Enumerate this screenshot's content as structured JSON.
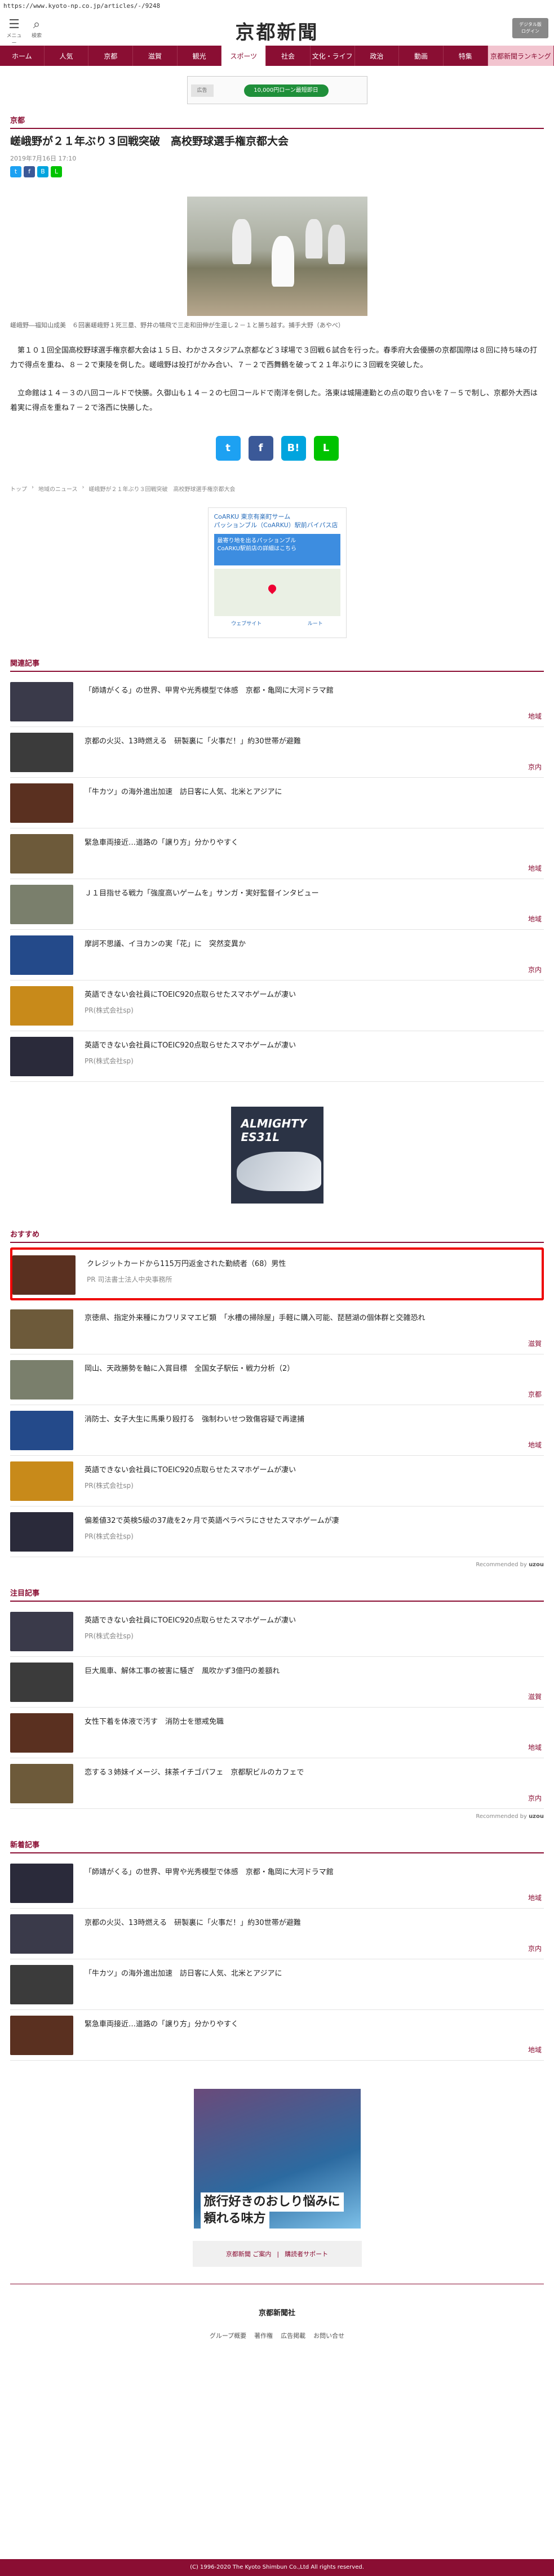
{
  "url": "https://www.kyoto-np.co.jp/articles/-/9248",
  "header": {
    "menu_label": "メニュー",
    "search_label": "検索",
    "logo": "京都新聞",
    "digital_label": "デジタル版\nログイン"
  },
  "nav": [
    "ホーム",
    "人気",
    "京都",
    "滋賀",
    "観光",
    "スポーツ",
    "社会",
    "文化・ライフ",
    "政治",
    "動画",
    "特集",
    "京都新聞ランキング"
  ],
  "ad_top": {
    "tag": "広告",
    "button": "10,000円ローン最短即日"
  },
  "article": {
    "section": "京都",
    "title": "嵯峨野が２１年ぶり３回戦突破　高校野球選手権京都大会",
    "date": "2019年7月16日 17:10",
    "caption": "嵯峨野―福知山成美　６回裏嵯峨野１死三塁、野井の犠飛で三走和田伸が生還し２－１と勝ち越す。捕手大野（あやべ）",
    "paragraphs": [
      "第１０１回全国高校野球選手権京都大会は１５日、わかさスタジアム京都など３球場で３回戦６試合を行った。春季府大会優勝の京都国際は８回に持ち味の打力で得点を重ね、８－２で東陵を倒した。嵯峨野は投打がかみ合い、７－２で西舞鶴を破って２１年ぶりに３回戦を突破した。",
      "立命館は１４－３の八回コールドで快勝。久御山も１４－２の七回コールドで南洋を倒した。洛東は城陽連勤との点の取り合いを７－５で制し、京都外大西は着実に得点を重ね７－２で洛西に快勝した。"
    ]
  },
  "breadcrumbs": [
    "トップ",
    "地域のニュース",
    "嵯峨野が２１年ぶり３回戦突破　高校野球選手権京都大会"
  ],
  "map_ad": {
    "title": "CoARKU 東京有楽町サーム\nパッションブル（CoARKU）駅前バイパス店",
    "box": "最寄り地を出るパッションブル\nCoARKU駅前店の詳細はこちら",
    "links": [
      "ウェブサイト",
      "ルート"
    ]
  },
  "related": {
    "heading": "関連記事",
    "items": [
      {
        "text": "「師靖がくる」の世界、甲冑や光秀模型で体感　京都・亀岡に大河ドラマ館",
        "src": "",
        "cat": "地域"
      },
      {
        "text": "京都の火災、13時燃える　研製裏に「火事だ！」約30世帯が避難",
        "src": "",
        "cat": "京内"
      },
      {
        "text": "「牛カツ」の海外進出加速　訪日客に人気、北米とアジアに",
        "src": "",
        "cat": ""
      },
      {
        "text": "緊急車両接近…道路の「譲り方」分かりやすく",
        "src": "",
        "cat": "地域"
      },
      {
        "text": "Ｊ１目指せる戦力「強度高いゲームを」サンガ・実好監督インタビュー",
        "src": "",
        "cat": "地域"
      },
      {
        "text": "摩訶不思議、イヨカンの実「花」に　突然変異か",
        "src": "",
        "cat": "京内"
      },
      {
        "text": "英語できない会社員にTOEIC920点取らせたスマホゲームが凄い",
        "src": "PR(株式会社sp)",
        "cat": ""
      },
      {
        "text": "英語できない会社員にTOEIC920点取らせたスマホゲームが凄い",
        "src": "PR(株式会社sp)",
        "cat": ""
      }
    ]
  },
  "ad_shoe": {
    "text": "ALMIGHTY\nES31L"
  },
  "recommend": {
    "heading": "おすすめ",
    "items": [
      {
        "text": "クレジットカードから115万円返金された勤続者（68）男性",
        "src": "PR 司法書士法人中央事務所",
        "cat": ""
      },
      {
        "text": "京徳県、指定外来種にカワリヌマエビ類　「水槽の掃除屋」手軽に購入可能、琵琶湖の個体群と交雑恐れ",
        "src": "",
        "cat": "滋賀"
      },
      {
        "text": "岡山、天政勝勢を軸に入賞目標　全国女子駅伝・戦力分析（2）",
        "src": "",
        "cat": "京都"
      },
      {
        "text": "消防士、女子大生に馬乗り殴打る　強制わいせつ致傷容疑で再逮捕",
        "src": "",
        "cat": "地域"
      },
      {
        "text": "英語できない会社員にTOEIC920点取らせたスマホゲームが凄い",
        "src": "PR(株式会社sp)",
        "cat": ""
      },
      {
        "text": "偏差値32で英検5級の37歳を2ヶ月で英語ペラペラにさせたスマホゲームが凄",
        "src": "PR(株式会社sp)",
        "cat": ""
      }
    ],
    "more": "Recommended by",
    "brand": "uzou"
  },
  "notable": {
    "heading": "注目記事",
    "items": [
      {
        "text": "英語できない会社員にTOEIC920点取らせたスマホゲームが凄い",
        "src": "PR(株式会社sp)",
        "cat": ""
      },
      {
        "text": "巨大風車、解体工事の被害に騒ぎ　風吹かず3億円の差額れ",
        "src": "",
        "cat": "滋賀"
      },
      {
        "text": "女性下着を体液で汚す　消防士を懲戒免職",
        "src": "",
        "cat": "地域"
      },
      {
        "text": "恋する３姉妹イメージ、抹茶イチゴパフェ　京都駅ビルのカフェで",
        "src": "",
        "cat": "京内"
      }
    ],
    "more": "Recommended by",
    "brand": "uzou"
  },
  "latest": {
    "heading": "新着記事",
    "items": [
      {
        "text": "「師靖がくる」の世界、甲冑や光秀模型で体感　京都・亀岡に大河ドラマ館",
        "src": "",
        "cat": "地域"
      },
      {
        "text": "京都の火災、13時燃える　研製裏に「火事だ！」約30世帯が避難",
        "src": "",
        "cat": "京内"
      },
      {
        "text": "「牛カツ」の海外進出加速　訪日客に人気、北米とアジアに",
        "src": "",
        "cat": ""
      },
      {
        "text": "緊急車両接近…道路の「譲り方」分かりやすく",
        "src": "",
        "cat": "地域"
      }
    ]
  },
  "ad_bottom": {
    "line1": "旅行好きのおしり悩みに",
    "line2": "頼れる味方"
  },
  "buttons": {
    "a": "京都新聞 ご案内",
    "b": "購読者サポート"
  },
  "footer": {
    "logo": "京都新聞社",
    "links": [
      "グループ概要",
      "著作権",
      "広告掲載",
      "お問い合せ"
    ],
    "copyright": "(C) 1996-2020 The Kyoto Shimbun Co.,Ltd All rights reserved."
  },
  "colors": {
    "brand": "#8a0e33",
    "highlight": "#ee0000"
  }
}
